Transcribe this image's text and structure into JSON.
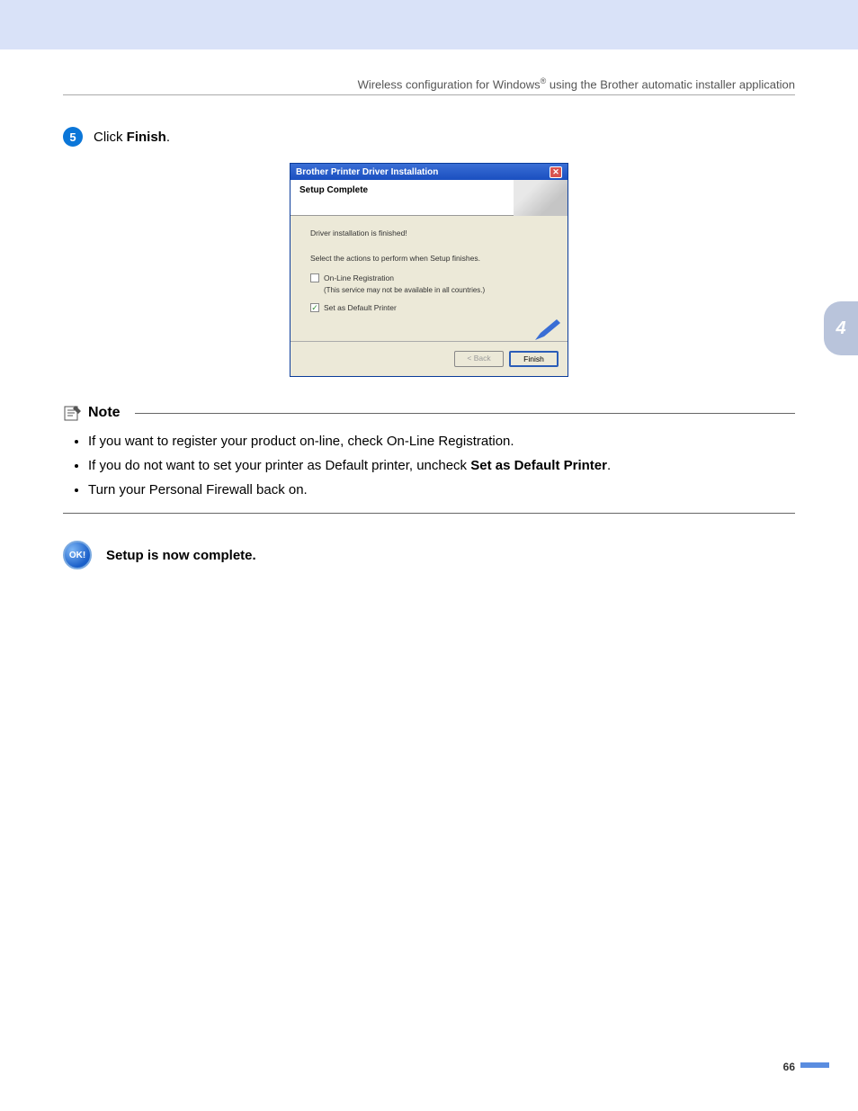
{
  "chapter_tab": "4",
  "header": {
    "prefix": "Wireless configuration for Windows",
    "suffix": " using the Brother automatic installer application"
  },
  "step": {
    "number": "5",
    "text_prefix": "Click ",
    "text_bold": "Finish",
    "text_suffix": "."
  },
  "dialog": {
    "title": "Brother Printer Driver Installation",
    "heading": "Setup Complete",
    "line1": "Driver installation is finished!",
    "line2": "Select the actions to perform when Setup finishes.",
    "checkbox1_label": "On-Line Registration",
    "checkbox1_sub": "(This service may not be available in all countries.)",
    "checkbox2_label": "Set as Default Printer",
    "back_btn": "< Back",
    "finish_btn": "Finish"
  },
  "note": {
    "title": "Note",
    "items": [
      "If you want to register your product on-line, check On-Line Registration.",
      {
        "prefix": "If you do not want to set your printer as Default printer, uncheck ",
        "bold": "Set as Default Printer",
        "suffix": "."
      },
      "Turn your Personal Firewall back on."
    ]
  },
  "ok_badge": "OK!",
  "complete_text": "Setup is now complete.",
  "page_number": "66"
}
